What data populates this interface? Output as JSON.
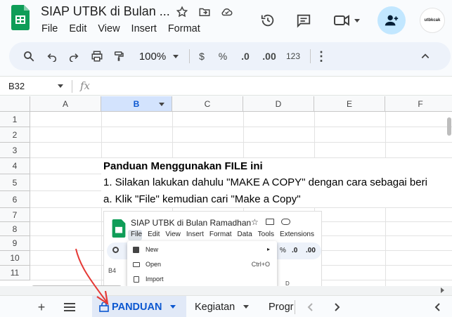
{
  "header": {
    "title": "SIAP UTBK di Bulan ...",
    "menu": [
      "File",
      "Edit",
      "View",
      "Insert",
      "Format"
    ],
    "avatar_text": "utbkcak"
  },
  "toolbar": {
    "zoom": "100%",
    "currency": "$",
    "percent": "%",
    "dec_decrease": ".0",
    "dec_increase": ".00",
    "number_format": "123"
  },
  "formula_bar": {
    "cell_ref": "B32",
    "fx": "fx"
  },
  "grid": {
    "columns": [
      "A",
      "B",
      "C",
      "D",
      "E",
      "F"
    ],
    "selected_column": "B",
    "rows": [
      "1",
      "2",
      "3",
      "4",
      "5",
      "6",
      "7",
      "8",
      "9",
      "10",
      "11"
    ],
    "cells": {
      "b4": "Panduan Menggunakan FILE ini",
      "b5": "1. Silakan lakukan dahulu \"MAKE A COPY\" dengan cara sebagai beri",
      "b6": "a. Klik \"File\" kemudian cari \"Make a Copy\""
    }
  },
  "embedded_screenshot": {
    "title": "SIAP UTBK di Bulan Ramadhan",
    "menu": [
      "File",
      "Edit",
      "View",
      "Insert",
      "Format",
      "Data",
      "Tools",
      "Extensions"
    ],
    "dropdown": [
      {
        "label": "New",
        "shortcut": "▸"
      },
      {
        "label": "Open",
        "shortcut": "Ctrl+O"
      },
      {
        "label": "Import",
        "shortcut": ""
      }
    ],
    "cell_ref": "B4",
    "col": "D",
    "percent": "%",
    "dec": ".0",
    "dec2": ".00"
  },
  "tabs": {
    "sheets": [
      "PANDUAN",
      "Kegiatan",
      "Progr"
    ],
    "active": "PANDUAN"
  },
  "colors": {
    "accent": "#0b57d0",
    "share_bg": "#c2e7ff",
    "selected_col_bg": "#d3e3fd",
    "annotation": "#e53935"
  }
}
